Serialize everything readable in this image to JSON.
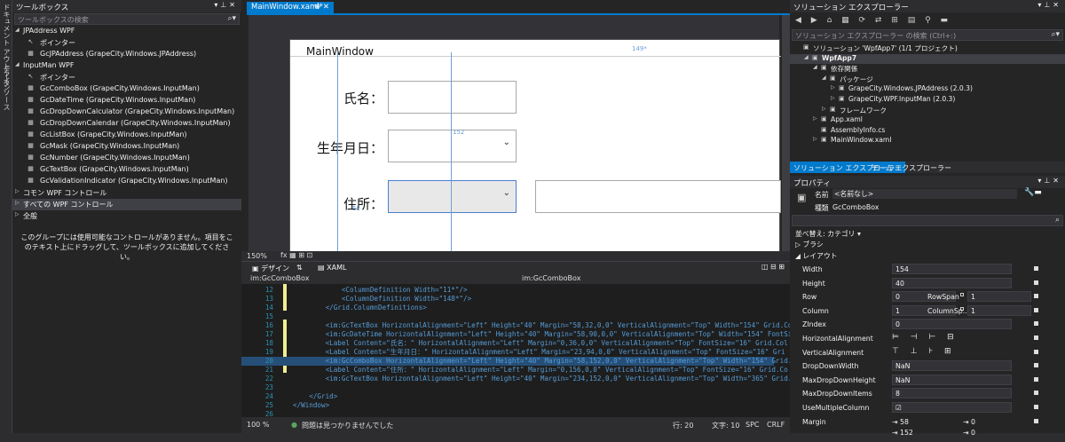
{
  "side_tabs": [
    "ドキュメント アウトライン",
    "データ ソース"
  ],
  "toolbox": {
    "title": "ツールボックス",
    "search_placeholder": "ツールボックスの検索",
    "groups": [
      {
        "name": "JPAddress WPF",
        "items": [
          "ポインター",
          "GcJPAddress (GrapeCity.Windows.JPAddress)"
        ]
      },
      {
        "name": "InputMan WPF",
        "items": [
          "ポインター",
          "GcComboBox (GrapeCity.Windows.InputMan)",
          "GcDateTime (GrapeCity.Windows.InputMan)",
          "GcDropDownCalculator (GrapeCity.Windows.InputMan)",
          "GcDropDownCalendar (GrapeCity.Windows.InputMan)",
          "GcListBox (GrapeCity.Windows.InputMan)",
          "GcMask (GrapeCity.Windows.InputMan)",
          "GcNumber (GrapeCity.Windows.InputMan)",
          "GcTextBox (GrapeCity.Windows.InputMan)",
          "GcValidationIndicator (GrapeCity.Windows.InputMan)"
        ]
      },
      {
        "name": "コモン WPF コントロール",
        "items": []
      },
      {
        "name": "すべての WPF コントロール",
        "items": []
      },
      {
        "name": "全般",
        "items": []
      }
    ],
    "empty_message": "このグループには使用可能なコントロールがありません。項目をこのテキスト上にドラッグして、ツールボックスに追加してください。"
  },
  "editor": {
    "tab": "MainWindow.xaml*",
    "window_title": "MainWindow",
    "labels": [
      "氏名：",
      "生年月日：",
      "住所："
    ],
    "col_width": "149*",
    "row_height": "152",
    "margin_left": "58",
    "zoom": "150%",
    "design_tab": "デザイン",
    "xaml_tab": "XAML",
    "crumb_left": "im:GcComboBox",
    "crumb_right": "im:GcComboBox",
    "code_lines": [
      {
        "n": "12",
        "t": "            <ColumnDefinition Width=\"11*\"/>"
      },
      {
        "n": "13",
        "t": "            <ColumnDefinition Width=\"148*\"/>"
      },
      {
        "n": "14",
        "t": "        </Grid.ColumnDefinitions>"
      },
      {
        "n": "15",
        "t": ""
      },
      {
        "n": "16",
        "t": "        <im:GcTextBox HorizontalAlignment=\"Left\" Height=\"40\" Margin=\"58,32,0,0\" VerticalAlignment=\"Top\" Width=\"154\" Grid.Co"
      },
      {
        "n": "17",
        "t": "        <im:GcDateTime HorizontalAlignment=\"Left\" Height=\"40\" Margin=\"58,90,0,0\" VerticalAlignment=\"Top\" Width=\"154\" FontSi"
      },
      {
        "n": "18",
        "t": "        <Label Content=\"氏名：\" HorizontalAlignment=\"Left\" Margin=\"0,36,0,0\" VerticalAlignment=\"Top\" FontSize=\"16\" Grid.Col"
      },
      {
        "n": "19",
        "t": "        <Label Content=\"生年月日：\" HorizontalAlignment=\"Left\" Margin=\"23,94,0,0\" VerticalAlignment=\"Top\" FontSize=\"16\" Gri"
      },
      {
        "n": "20",
        "t": "        <im:GcComboBox HorizontalAlignment=\"Left\" Height=\"40\" Margin=\"58,152,0,0\" VerticalAlignment=\"Top\" Width=\"154\" Grid."
      },
      {
        "n": "21",
        "t": "        <Label Content=\"住所：\" HorizontalAlignment=\"Left\" Margin=\"0,156,0,0\" VerticalAlignment=\"Top\" FontSize=\"16\" Grid.Co"
      },
      {
        "n": "22",
        "t": "        <im:GcTextBox HorizontalAlignment=\"Left\" Height=\"40\" Margin=\"234,152,0,0\" VerticalAlignment=\"Top\" Width=\"365\" Grid."
      },
      {
        "n": "23",
        "t": ""
      },
      {
        "n": "24",
        "t": "    </Grid>"
      },
      {
        "n": "25",
        "t": "</Window>"
      },
      {
        "n": "26",
        "t": ""
      }
    ],
    "status": {
      "zoom": "100 %",
      "issues": "問題は見つかりませんでした",
      "line": "行: 20",
      "char": "文字: 10",
      "spc": "SPC",
      "crlf": "CRLF"
    }
  },
  "solution": {
    "title": "ソリューション エクスプローラー",
    "search_placeholder": "ソリューション エクスプローラー の検索 (Ctrl+:)",
    "tree": [
      {
        "d": 0,
        "t": "ソリューション 'WpfApp7' (1/1 プロジェクト)",
        "tri": ""
      },
      {
        "d": 1,
        "t": "WpfApp7",
        "tri": "◢"
      },
      {
        "d": 2,
        "t": "依存関係",
        "tri": "◢"
      },
      {
        "d": 3,
        "t": "パッケージ",
        "tri": "◢"
      },
      {
        "d": 4,
        "t": "GrapeCity.Windows.JPAddress (2.0.3)",
        "tri": "▷"
      },
      {
        "d": 4,
        "t": "GrapeCity.WPF.InputMan (2.0.3)",
        "tri": "▷"
      },
      {
        "d": 3,
        "t": "フレームワーク",
        "tri": "▷"
      },
      {
        "d": 2,
        "t": "App.xaml",
        "tri": "▷"
      },
      {
        "d": 2,
        "t": "AssemblyInfo.cs",
        "tri": ""
      },
      {
        "d": 2,
        "t": "MainWindow.xaml",
        "tri": "▷"
      }
    ],
    "tab1": "ソリューション エクスプローラー",
    "tab2": "チーム エクスプローラー"
  },
  "properties": {
    "title": "プロパティ",
    "name_label": "名前",
    "name_value": "<名前なし>",
    "type_label": "種類",
    "type_value": "GcComboBox",
    "sort": "並べ替え: カテゴリ ▾",
    "cat_brush": "ブラシ",
    "cat_layout": "レイアウト",
    "rows": [
      {
        "n": "Width",
        "v": "154"
      },
      {
        "n": "Height",
        "v": "40"
      },
      {
        "n": "Row",
        "v": "0",
        "n2": "RowSpan",
        "v2": "1"
      },
      {
        "n": "Column",
        "v": "1",
        "n2": "ColumnSp...",
        "v2": "1"
      },
      {
        "n": "ZIndex",
        "v": "0"
      },
      {
        "n": "HorizontalAlignment",
        "v": ""
      },
      {
        "n": "VerticalAlignment",
        "v": ""
      },
      {
        "n": "DropDownWidth",
        "v": "NaN"
      },
      {
        "n": "MaxDropDownHeight",
        "v": "NaN"
      },
      {
        "n": "MaxDropDownItems",
        "v": "8"
      },
      {
        "n": "UseMultipleColumn",
        "v": "☑"
      },
      {
        "n": "Margin",
        "v": "58",
        "v2": "0"
      }
    ],
    "margin2": "152",
    "margin2b": "0"
  }
}
